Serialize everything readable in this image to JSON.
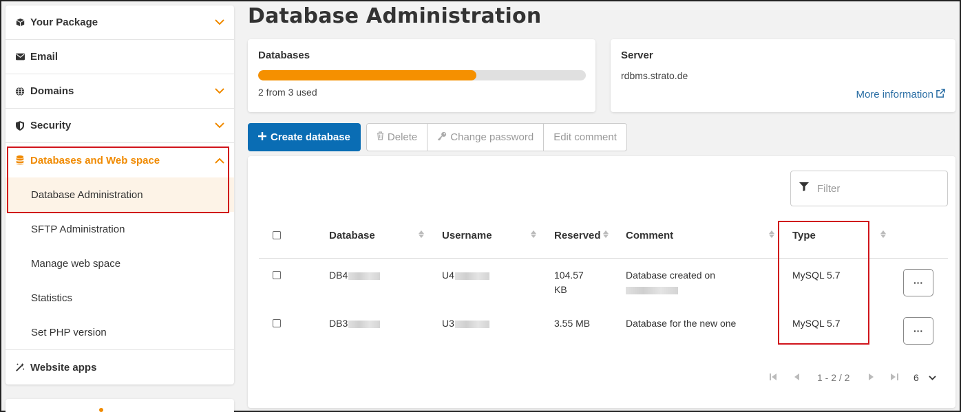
{
  "sidebar": {
    "items": [
      {
        "label": "Your Package",
        "icon": "box-icon",
        "expandable": true
      },
      {
        "label": "Email",
        "icon": "envelope-icon",
        "expandable": false
      },
      {
        "label": "Domains",
        "icon": "globe-icon",
        "expandable": true
      },
      {
        "label": "Security",
        "icon": "shield-icon",
        "expandable": true
      },
      {
        "label": "Databases and Web space",
        "icon": "database-icon",
        "expandable": true,
        "expanded": true
      }
    ],
    "subitems": [
      {
        "label": "Database Administration",
        "selected": true
      },
      {
        "label": "SFTP Administration"
      },
      {
        "label": "Manage web space"
      },
      {
        "label": "Statistics"
      },
      {
        "label": "Set PHP version"
      }
    ],
    "website_apps": {
      "label": "Website apps",
      "icon": "magic-wand-icon"
    }
  },
  "page": {
    "title": "Database Administration"
  },
  "databases_card": {
    "title": "Databases",
    "usage_text": "2 from 3 used",
    "used": 2,
    "total": 3
  },
  "server_card": {
    "title": "Server",
    "host": "rdbms.strato.de",
    "more_info": "More information"
  },
  "toolbar": {
    "create": "Create database",
    "delete": "Delete",
    "change_password": "Change password",
    "edit_comment": "Edit comment"
  },
  "filter": {
    "placeholder": "Filter"
  },
  "table": {
    "headers": {
      "database": "Database",
      "username": "Username",
      "reserved": "Reserved",
      "comment": "Comment",
      "type": "Type"
    },
    "rows": [
      {
        "database": "DB4",
        "username": "U4",
        "reserved_line1": "104.57",
        "reserved_line2": "KB",
        "comment": "Database created on",
        "type": "MySQL 5.7",
        "actions": "···"
      },
      {
        "database": "DB3",
        "username": "U3",
        "reserved_line1": "3.55 MB",
        "reserved_line2": "",
        "comment": "Database for the new one",
        "type": "MySQL 5.7",
        "actions": "···"
      }
    ]
  },
  "pagination": {
    "range": "1 - 2 / 2",
    "page_size": "6"
  },
  "colors": {
    "accent": "#f08a00",
    "primary": "#0a6db4",
    "highlight": "#d0141b",
    "link": "#2c6fa5"
  }
}
